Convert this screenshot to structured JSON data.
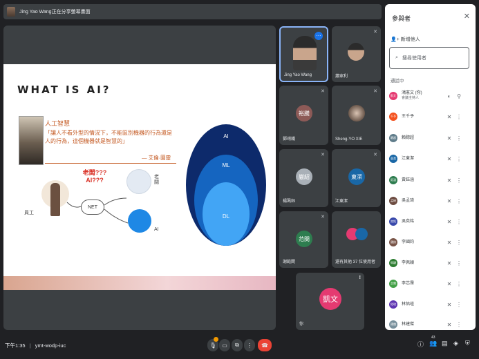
{
  "banner": {
    "text": "Jing Yao Wang正在分享螢幕畫面"
  },
  "slide": {
    "title": "WHAT IS AI?",
    "quote_heading": "人工智慧",
    "quote_body": "「讓人不看外型的情況下，不能區別機器的行為還是人的行為，這個機器就是智慧的」",
    "quote_attribution": "— 艾倫·圖靈",
    "diagram_question": "老闆???\nAI???",
    "label_worker": "員工",
    "label_net": "NET",
    "label_boss": "老闆",
    "label_ai": "AI",
    "circle_labels": [
      "AI",
      "ML",
      "DL"
    ]
  },
  "tiles": [
    {
      "name": "Jing Yao Wang",
      "active": true
    },
    {
      "name": "蕭家利"
    },
    {
      "name": "鄧琍鐵",
      "initials": "裕騰",
      "color": "#8d5a57"
    },
    {
      "name": "Sheng-YO XIE"
    },
    {
      "name": "楊珮鈺",
      "initials": "巖紹",
      "color": "#a9b0b7"
    },
    {
      "name": "江東潔",
      "initials": "東潔",
      "color": "#1967a6"
    },
    {
      "name": "謝範閔",
      "initials": "范閔",
      "color": "#2e7d4f"
    },
    {
      "name": "還有其他 37 位使用者"
    },
    {
      "name": "你",
      "initials": "凱文",
      "color": "#e53a71"
    }
  ],
  "participants_panel": {
    "title": "參與者",
    "add_label": "新增他人",
    "search_placeholder": "搜尋使用者",
    "section_label": "通話中",
    "people": [
      {
        "name": "鴻憲文 (你)",
        "sub": "會議主持人",
        "color": "#e53a71",
        "initials": "凱文"
      },
      {
        "name": "王千予",
        "color": "#f4511e",
        "initials": "千予"
      },
      {
        "name": "賴聰超",
        "color": "#607d8b",
        "initials": "聰超"
      },
      {
        "name": "江東潔",
        "color": "#1967a6",
        "initials": "東潔"
      },
      {
        "name": "黃鈺涵",
        "color": "#2e7d4f",
        "initials": "鈺涵"
      },
      {
        "name": "吳孟琦",
        "color": "#6d4c41",
        "initials": "孟琦"
      },
      {
        "name": "吳奕銘",
        "color": "#3949ab",
        "initials": "奕銘"
      },
      {
        "name": "李國鈞",
        "color": "#795548",
        "initials": "國鈞"
      },
      {
        "name": "李佩穎",
        "color": "#2e7d32",
        "initials": "佩穎"
      },
      {
        "name": "李芯霈",
        "color": "#43a047",
        "initials": "芯霈"
      },
      {
        "name": "林佑瑄",
        "color": "#5e35b1",
        "initials": "佑瑄"
      },
      {
        "name": "林建傑",
        "color": "#78909c",
        "initials": "建傑"
      }
    ]
  },
  "bottom_bar": {
    "time": "下午1:35",
    "meeting_code": "ymt-wodp-iuc",
    "participant_count": "43"
  }
}
